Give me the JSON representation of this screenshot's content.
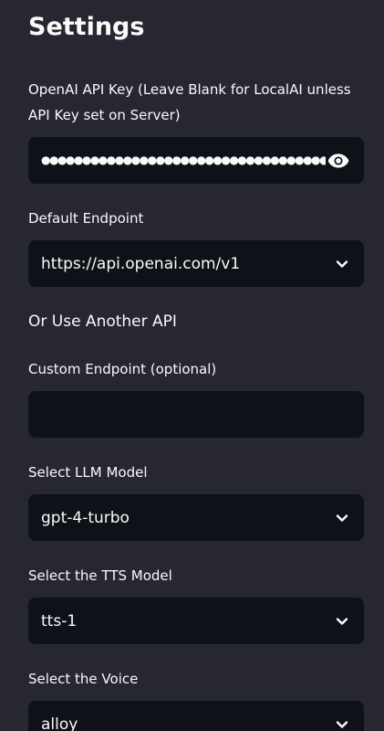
{
  "sidebar": {
    "title": "Settings",
    "api_key": {
      "label": "OpenAI API Key (Leave Blank for LocalAI unless API Key set on Server)",
      "masked_value": "●●●●●●●●●●●●●●●●●●●●●●●●●●●●●●●●●●●●●●●●●●●",
      "toggle_icon": "eye-icon"
    },
    "default_endpoint": {
      "label": "Default Endpoint",
      "selected": "https://api.openai.com/v1"
    },
    "alt_api_heading": "Or Use Another API",
    "custom_endpoint": {
      "label": "Custom Endpoint (optional)",
      "value": "",
      "placeholder": ""
    },
    "llm_model": {
      "label": "Select LLM Model",
      "selected": "gpt-4-turbo"
    },
    "tts_model": {
      "label": "Select the TTS Model",
      "selected": "tts-1"
    },
    "voice": {
      "label": "Select the Voice",
      "selected": "alloy"
    }
  },
  "colors": {
    "sidebar_bg": "#262730",
    "input_bg": "#0e1117",
    "text": "#fafafa"
  }
}
